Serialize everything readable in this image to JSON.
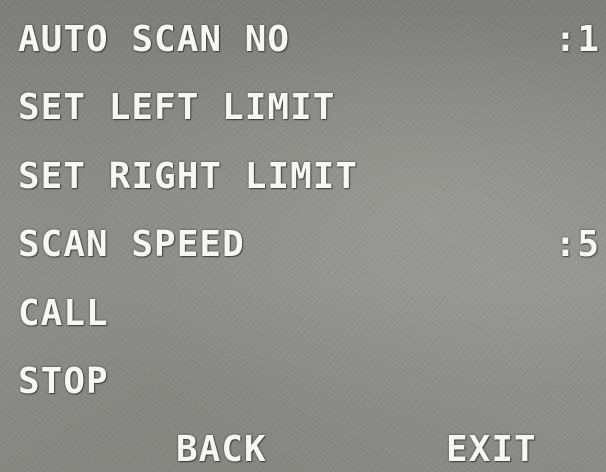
{
  "menu": {
    "items": [
      {
        "label": "AUTO SCAN NO",
        "value": ":1"
      },
      {
        "label": "SET LEFT LIMIT"
      },
      {
        "label": "SET RIGHT LIMIT"
      },
      {
        "label": "SCAN SPEED",
        "value": ":5"
      },
      {
        "label": "CALL"
      },
      {
        "label": "STOP"
      }
    ],
    "back_label": "BACK",
    "exit_label": "EXIT"
  }
}
